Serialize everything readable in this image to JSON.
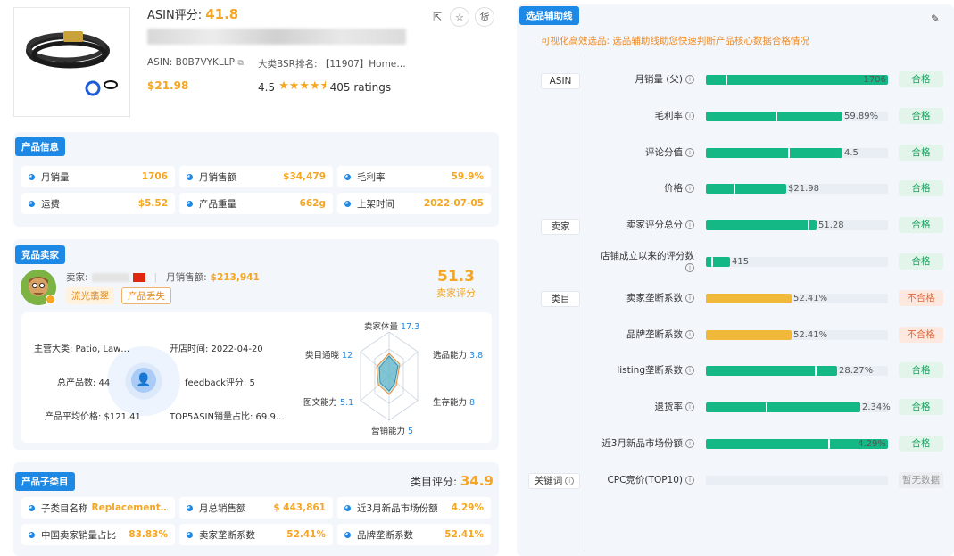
{
  "product": {
    "asin_score_label": "ASIN评分:",
    "asin_score": "41.8",
    "asin": "ASIN: B0B7VYKLLP",
    "bsr": "大类BSR排名: 【11907】Home…",
    "price": "$21.98",
    "rating_value": "4.5",
    "rating_count": "405 ratings",
    "actions": [
      "share-icon",
      "star-icon",
      "货"
    ]
  },
  "product_info": {
    "title": "产品信息",
    "cells": [
      {
        "label": "月销量",
        "value": "1706"
      },
      {
        "label": "月销售额",
        "value": "$34,479"
      },
      {
        "label": "毛利率",
        "value": "59.9%"
      },
      {
        "label": "运费",
        "value": "$5.52"
      },
      {
        "label": "产品重量",
        "value": "662g"
      },
      {
        "label": "上架时间",
        "value": "2022-07-05"
      }
    ]
  },
  "seller": {
    "title": "竞品卖家",
    "seller_label": "卖家:",
    "monthly_sales_label": "月销售额:",
    "monthly_sales": "$213,941",
    "tags": [
      "流光翡翠",
      "产品丢失"
    ],
    "score": "51.3",
    "score_label": "卖家评分",
    "main_category": "主营大类: Patio, Law…",
    "open_time": "开店时间: 2022-04-20",
    "total_products": "总产品数: 44",
    "feedback": "feedback评分: 5",
    "avg_price": "产品平均价格: $121.41",
    "top5": "TOP5ASIN销量占比: 69.9…",
    "radar": {
      "axes": [
        {
          "label": "卖家体量",
          "value": "17.3"
        },
        {
          "label": "选品能力",
          "value": "3.8"
        },
        {
          "label": "生存能力",
          "value": "8"
        },
        {
          "label": "营销能力",
          "value": "5"
        },
        {
          "label": "图文能力",
          "value": "5.1"
        },
        {
          "label": "类目通晓",
          "value": "12"
        }
      ]
    }
  },
  "subcategory": {
    "title": "产品子类目",
    "score_label": "类目评分:",
    "score": "34.9",
    "cells": [
      {
        "label": "子类目名称",
        "value": "Replacement…"
      },
      {
        "label": "月总销售额",
        "value": "$ 443,861"
      },
      {
        "label": "近3月新品市场份额",
        "value": "4.29%"
      },
      {
        "label": "中国卖家销量占比",
        "value": "83.83%"
      },
      {
        "label": "卖家垄断系数",
        "value": "52.41%"
      },
      {
        "label": "品牌垄断系数",
        "value": "52.41%"
      }
    ]
  },
  "guide": {
    "title": "选品辅助线",
    "subtitle": "可视化高效选品: 选品辅助线助您快速判断产品核心数据合格情况",
    "groups": [
      "ASIN",
      "卖家",
      "类目",
      "关键词"
    ],
    "rows": [
      {
        "label": "月销量 (父)",
        "value": "1706",
        "fill": 1.0,
        "mark": 0.11,
        "color": "#14b885",
        "status": "合格",
        "pass": true
      },
      {
        "label": "毛利率",
        "value": "59.89%",
        "fill": 0.75,
        "mark": 0.38,
        "color": "#14b885",
        "status": "合格",
        "pass": true
      },
      {
        "label": "评论分值",
        "value": "4.5",
        "fill": 0.75,
        "mark": 0.45,
        "color": "#14b885",
        "status": "合格",
        "pass": true
      },
      {
        "label": "价格",
        "value": "$21.98",
        "fill": 0.44,
        "mark": 0.15,
        "color": "#14b885",
        "status": "合格",
        "pass": true
      },
      {
        "label": "卖家评分总分",
        "value": "51.28",
        "fill": 0.61,
        "mark": 0.56,
        "color": "#14b885",
        "status": "合格",
        "pass": true
      },
      {
        "label": "店铺成立以来的评分数",
        "value": "415",
        "fill": 0.13,
        "mark": 0.03,
        "color": "#14b885",
        "status": "合格",
        "pass": true
      },
      {
        "label": "卖家垄断系数",
        "value": "52.41%",
        "fill": 0.47,
        "mark": null,
        "color": "#f0b93a",
        "status": "不合格",
        "pass": false
      },
      {
        "label": "品牌垄断系数",
        "value": "52.41%",
        "fill": 0.47,
        "mark": null,
        "color": "#f0b93a",
        "status": "不合格",
        "pass": false
      },
      {
        "label": "listing垄断系数",
        "value": "28.27%",
        "fill": 0.72,
        "mark": 0.6,
        "color": "#14b885",
        "status": "合格",
        "pass": true
      },
      {
        "label": "退货率",
        "value": "2.34%",
        "fill": 0.85,
        "mark": 0.33,
        "color": "#14b885",
        "status": "合格",
        "pass": true
      },
      {
        "label": "近3月新品市场份额",
        "value": "4.29%",
        "fill": 1.0,
        "mark": 0.67,
        "color": "#14b885",
        "status": "合格",
        "pass": true
      },
      {
        "label": "CPC竞价(TOP10)",
        "value": "",
        "fill": 0,
        "mark": null,
        "color": "#14b885",
        "status": "暂无数据",
        "pass": null
      }
    ]
  }
}
